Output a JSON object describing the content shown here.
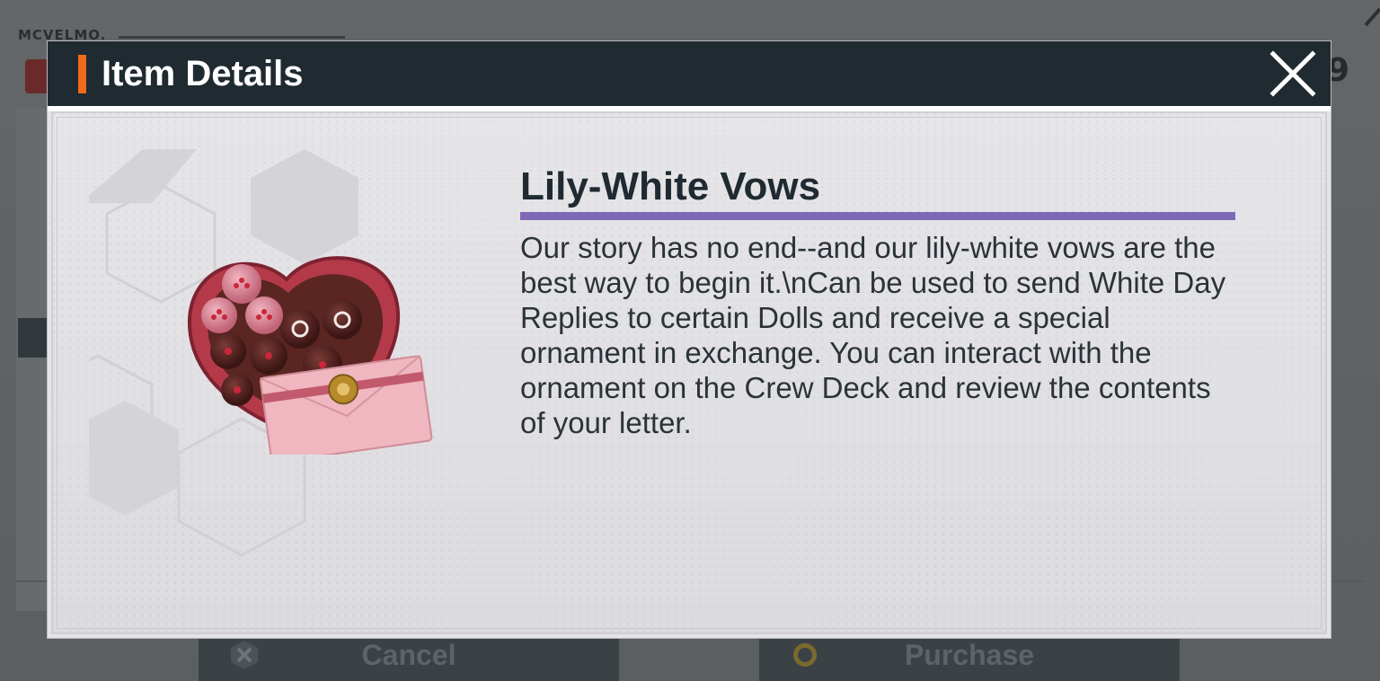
{
  "background": {
    "logo_text": "MCVELMO.",
    "corner_number": "9",
    "cancel_label": "Cancel",
    "purchase_label": "Purchase"
  },
  "modal": {
    "title": "Item Details",
    "close_icon": "close-x-icon",
    "item": {
      "name": "Lily-White Vows",
      "description": "Our story has no end--and our lily-white vows are the best way to begin it.\\nCan be used to send White Day Replies to certain Dolls and receive a special ornament in exchange. You can interact with the ornament on the Crew Deck and review the contents of your letter.",
      "image_icon": "heart-chocolate-box-with-letter-icon"
    }
  },
  "colors": {
    "header_bg": "#1f2a31",
    "accent_orange": "#f26a1b",
    "underline_purple": "#7f68b8",
    "body_bg": "#e4e3e6"
  }
}
